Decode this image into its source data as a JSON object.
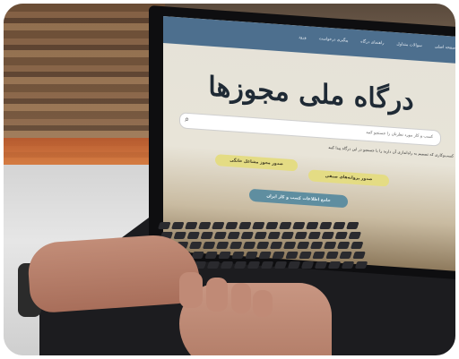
{
  "portal": {
    "nav": [
      "صفحه اصلی",
      "سوالات متداول",
      "راهنمای درگاه",
      "پیگیری درخواست",
      "ورود"
    ],
    "title": "درگاه ملی مجوزها",
    "search_placeholder": "کسب و کار مورد نظرتان را جستجو کنید",
    "hint": "کسب‌وکاری که تصمیم به راه‌اندازی آن دارید را با جستجو در این درگاه پیدا کنید",
    "buttons": {
      "license_issue": "صدور مجوز مشاغل خانگی",
      "business_permits": "صدور پروانه‌های صنفی",
      "guide": "جامع اطلاعات کسب و کار ایران"
    }
  }
}
